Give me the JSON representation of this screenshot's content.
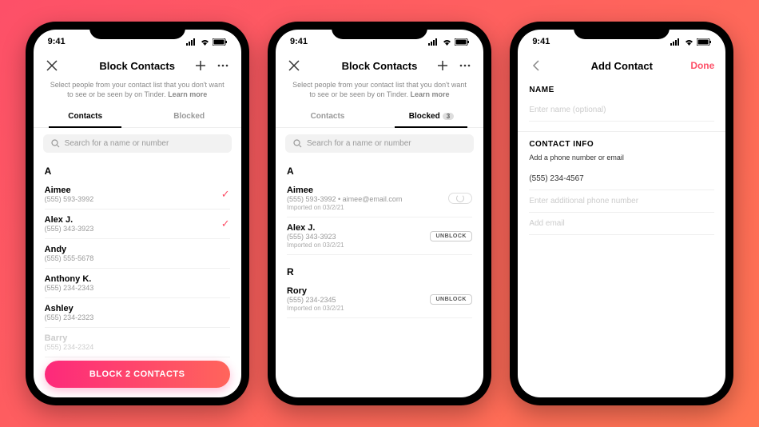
{
  "status": {
    "time": "9:41"
  },
  "phone1": {
    "title": "Block Contacts",
    "subtitle_a": "Select people from your contact list that you don't want to see or be seen by on Tinder. ",
    "subtitle_b": "Learn more",
    "tabs": {
      "contacts": "Contacts",
      "blocked": "Blocked"
    },
    "search_placeholder": "Search for a name or number",
    "section_a": "A",
    "contacts": [
      {
        "name": "Aimee",
        "phone": "(555) 593-3992",
        "selected": true
      },
      {
        "name": "Alex J.",
        "phone": "(555) 343-3923",
        "selected": true
      },
      {
        "name": "Andy",
        "phone": "(555) 555-5678",
        "selected": false
      },
      {
        "name": "Anthony K.",
        "phone": "(555) 234-2343",
        "selected": false
      },
      {
        "name": "Ashley",
        "phone": "(555) 234-2323",
        "selected": false
      },
      {
        "name": "Barry",
        "phone": "(555) 234-2324",
        "selected": false
      }
    ],
    "cta": "BLOCK 2 CONTACTS"
  },
  "phone2": {
    "title": "Block Contacts",
    "subtitle_a": "Select people from your contact list that you don't want to see or be seen by on Tinder. ",
    "subtitle_b": "Learn more",
    "tabs": {
      "contacts": "Contacts",
      "blocked": "Blocked",
      "badge": "3"
    },
    "search_placeholder": "Search for a name or number",
    "section_a": "A",
    "section_r": "R",
    "unblock_label": "UNBLOCK",
    "contacts_a": [
      {
        "name": "Aimee",
        "detail": "(555) 593-3992  •  aimee@email.com",
        "meta": "Imported on 03/2/21",
        "loading": true
      },
      {
        "name": "Alex J.",
        "detail": "(555) 343-3923",
        "meta": "Imported on 03/2/21",
        "loading": false
      }
    ],
    "contacts_r": [
      {
        "name": "Rory",
        "detail": "(555) 234-2345",
        "meta": "Imported on 03/2/21",
        "loading": false
      }
    ]
  },
  "phone3": {
    "title": "Add Contact",
    "done": "Done",
    "name_label": "NAME",
    "name_placeholder": "Enter name (optional)",
    "info_label": "CONTACT INFO",
    "info_sublabel": "Add a phone number or email",
    "phone_value": "(555) 234-4567",
    "phone2_placeholder": "Enter additional phone number",
    "email_placeholder": "Add email"
  }
}
